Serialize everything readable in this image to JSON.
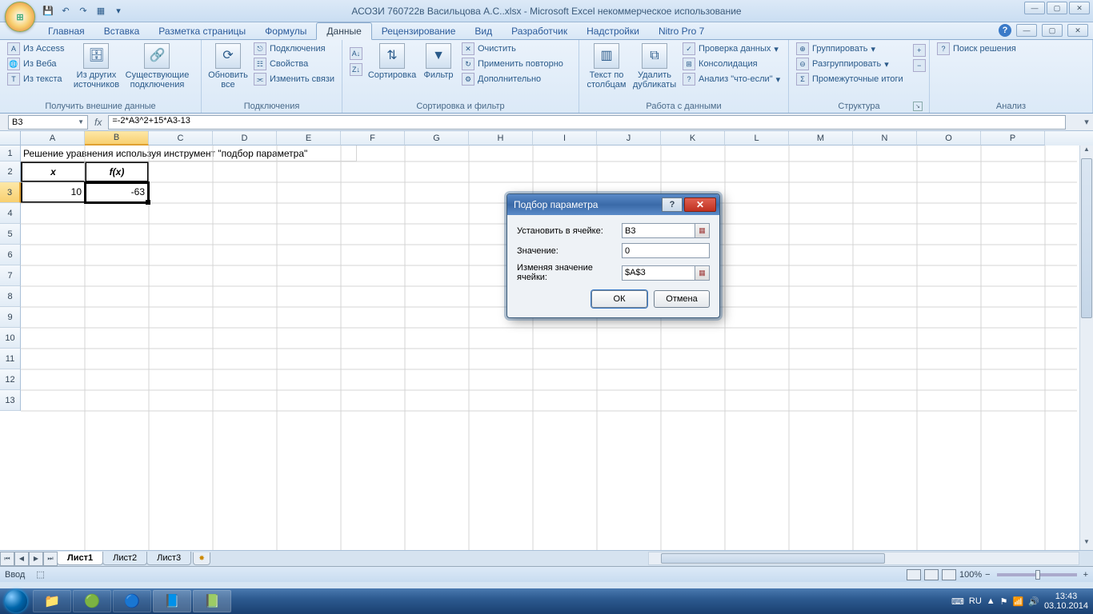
{
  "title": "АСОЗИ 760722в Васильцова А.С..xlsx - Microsoft Excel некоммерческое использование",
  "tabs": {
    "home": "Главная",
    "insert": "Вставка",
    "layout": "Разметка страницы",
    "formulas": "Формулы",
    "data": "Данные",
    "review": "Рецензирование",
    "view": "Вид",
    "developer": "Разработчик",
    "addins": "Надстройки",
    "nitro": "Nitro Pro 7"
  },
  "ribbon": {
    "ext": {
      "access": "Из Access",
      "web": "Из Веба",
      "text": "Из текста",
      "other": "Из других источников",
      "existing": "Существующие подключения",
      "group": "Получить внешние данные"
    },
    "conn": {
      "refresh": "Обновить все",
      "connections": "Подключения",
      "properties": "Свойства",
      "editlinks": "Изменить связи",
      "group": "Подключения"
    },
    "sort": {
      "sort": "Сортировка",
      "filter": "Фильтр",
      "clear": "Очистить",
      "reapply": "Применить повторно",
      "advanced": "Дополнительно",
      "group": "Сортировка и фильтр"
    },
    "tools": {
      "t2c": "Текст по столбцам",
      "dup": "Удалить дубликаты",
      "valid": "Проверка данных",
      "consol": "Консолидация",
      "whatif": "Анализ \"что-если\"",
      "group": "Работа с данными"
    },
    "outline": {
      "grp": "Группировать",
      "ungrp": "Разгруппировать",
      "subt": "Промежуточные итоги",
      "group": "Структура"
    },
    "analysis": {
      "solver": "Поиск решения",
      "group": "Анализ"
    }
  },
  "namebox": "B3",
  "formula": "=-2*A3^2+15*A3-13",
  "columns": [
    "A",
    "B",
    "C",
    "D",
    "E",
    "F",
    "G",
    "H",
    "I",
    "J",
    "K",
    "L",
    "M",
    "N",
    "O",
    "P"
  ],
  "rows": [
    "1",
    "2",
    "3",
    "4",
    "5",
    "6",
    "7",
    "8",
    "9",
    "10",
    "11",
    "12",
    "13"
  ],
  "cells": {
    "a1": "Решение уравнения используя инструмент \"подбор параметра\"",
    "a2": "x",
    "b2": "f(x)",
    "a3": "10",
    "b3": "-63"
  },
  "sheets": {
    "s1": "Лист1",
    "s2": "Лист2",
    "s3": "Лист3"
  },
  "status": "Ввод",
  "zoom": "100%",
  "dialog": {
    "title": "Подбор параметра",
    "set_cell": "Установить в ячейке:",
    "to_value": "Значение:",
    "by_changing": "Изменяя значение ячейки:",
    "val_setcell": "B3",
    "val_value": "0",
    "val_change": "$A$3",
    "ok": "ОК",
    "cancel": "Отмена"
  },
  "tray": {
    "lang": "RU",
    "time": "13:43",
    "date": "03.10.2014"
  }
}
